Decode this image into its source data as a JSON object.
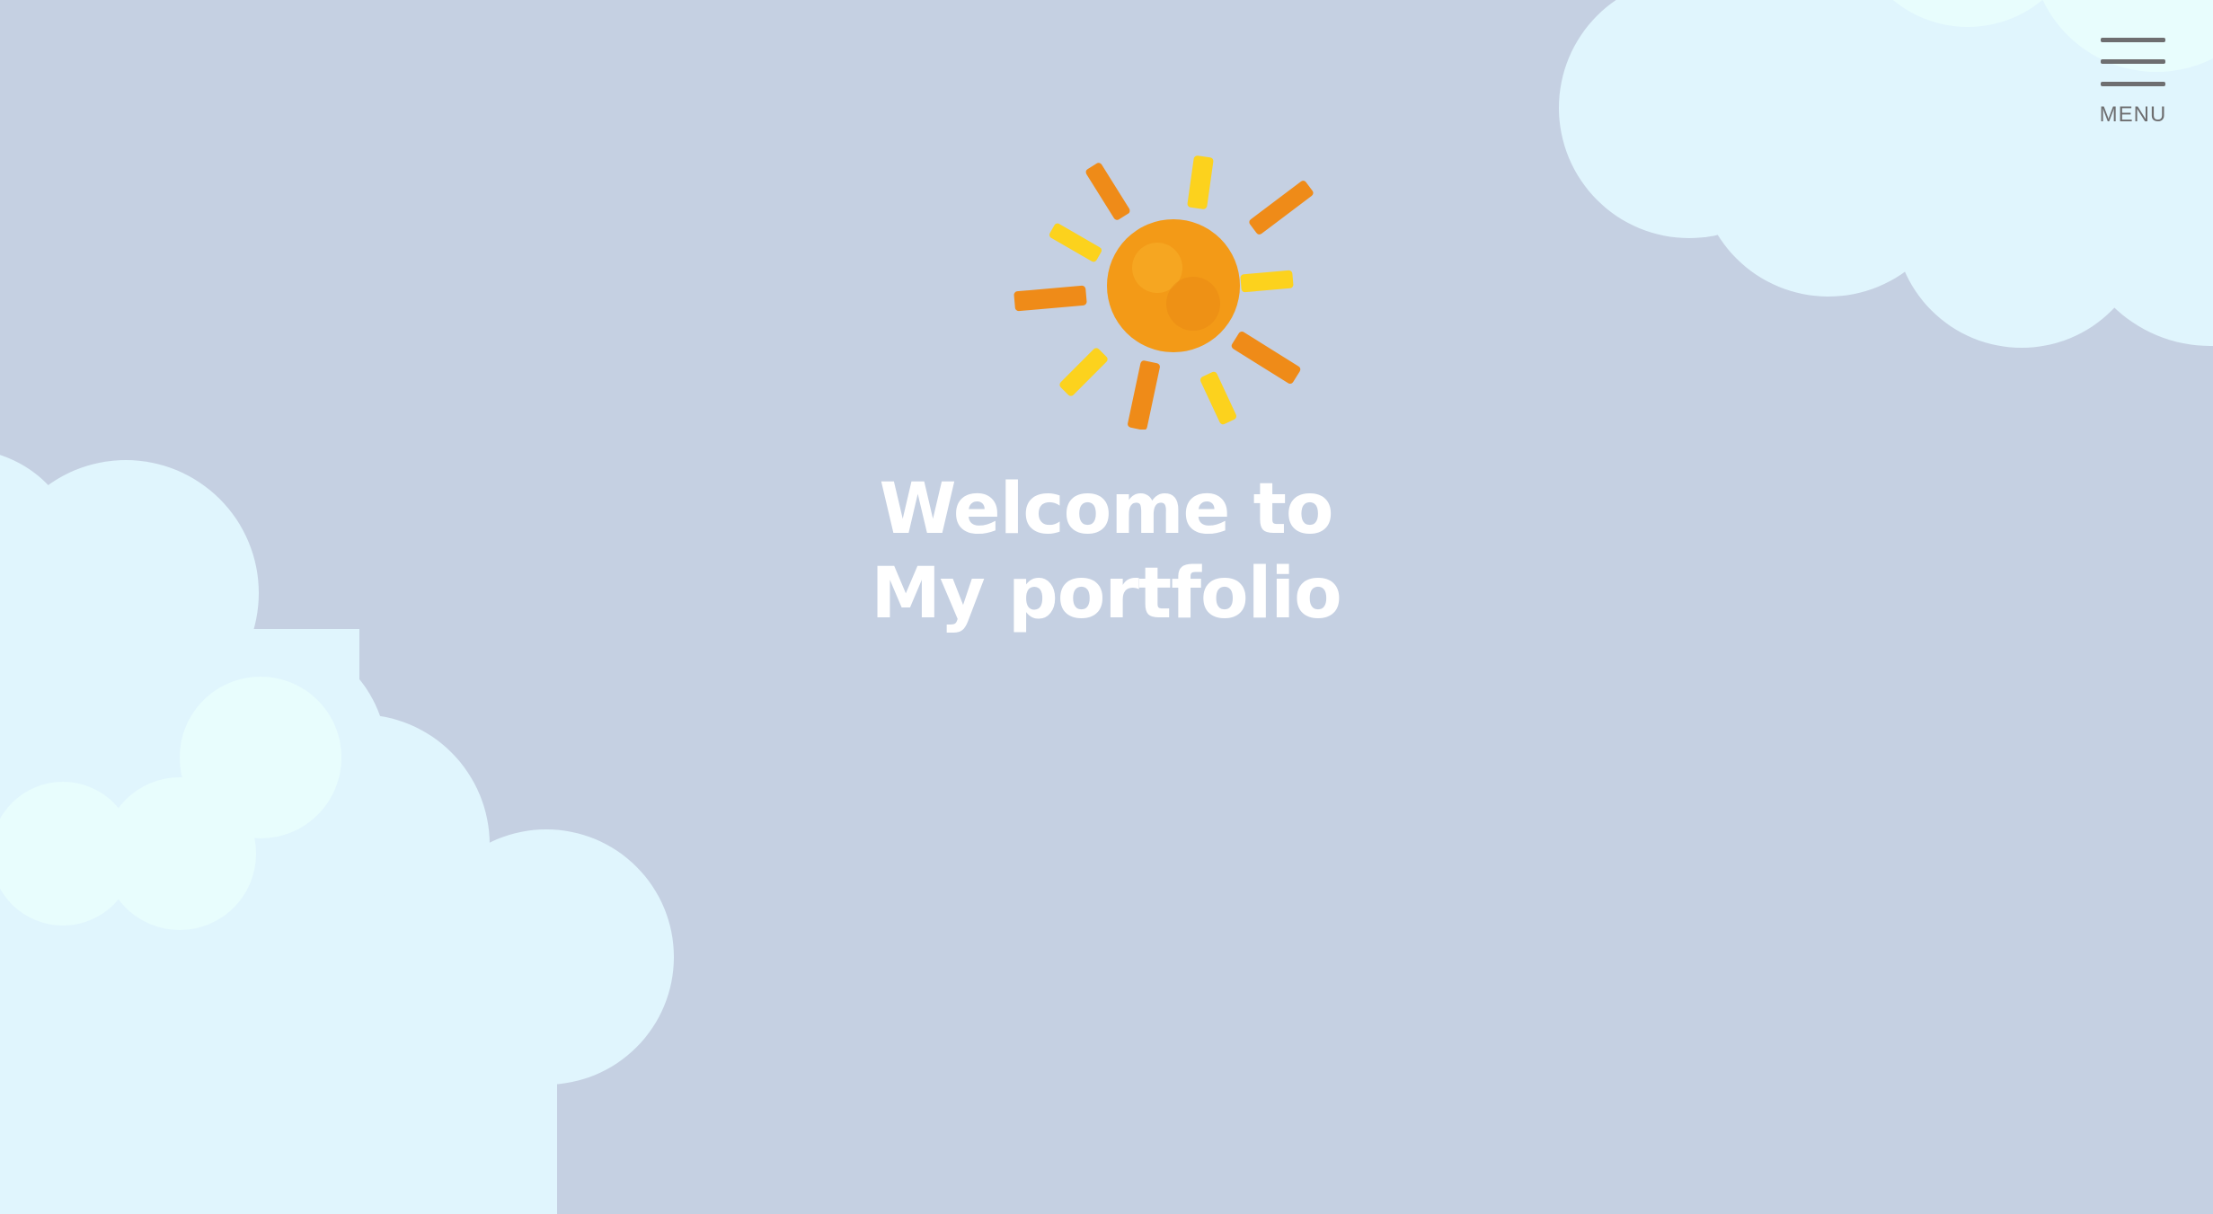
{
  "page": {
    "background_color": "#c5d0e2",
    "cloud_color": "#e0f5fd",
    "cloud_highlight_color": "#e8fdfd"
  },
  "hero": {
    "line1": "Welcome to",
    "line2": "My portfolio",
    "text_color": "#ffffff"
  },
  "sun": {
    "icon": "sun-icon",
    "core_color": "#f39a17",
    "ray_colors": [
      "#ef8b18",
      "#fcd21d"
    ]
  },
  "menu": {
    "icon": "hamburger-icon",
    "label": "MENU",
    "color": "#6e6e70"
  }
}
